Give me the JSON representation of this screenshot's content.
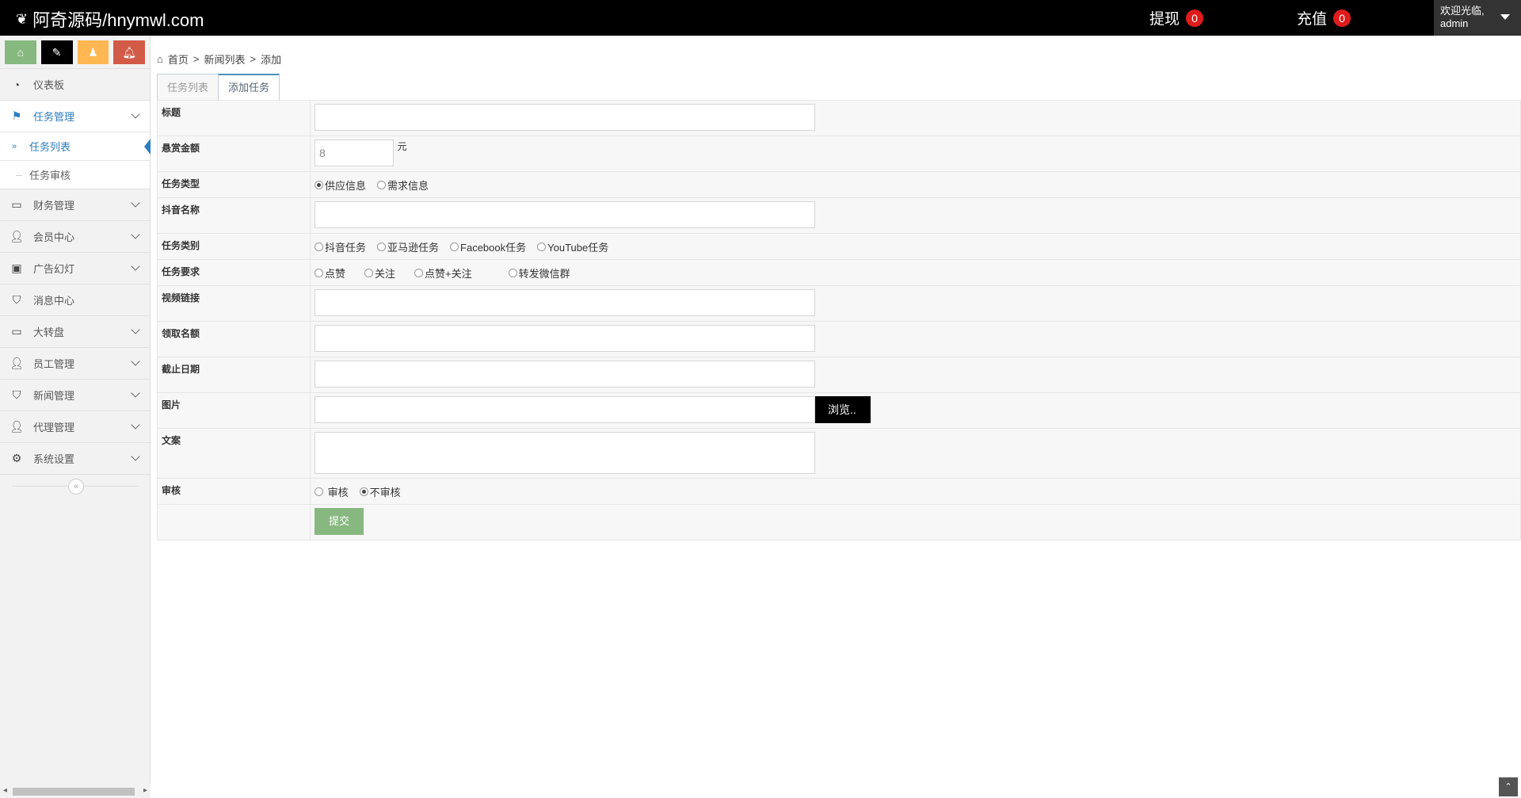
{
  "header": {
    "brand": "阿奇源码/hnymwl.com",
    "withdraw": {
      "label": "提现",
      "count": "0"
    },
    "recharge": {
      "label": "充值",
      "count": "0"
    },
    "user": {
      "welcome": "欢迎光临,",
      "name": "admin"
    }
  },
  "sidebar": {
    "items": [
      {
        "label": "仪表板"
      },
      {
        "label": "任务管理"
      },
      {
        "label": "财务管理"
      },
      {
        "label": "会员中心"
      },
      {
        "label": "广告幻灯"
      },
      {
        "label": "消息中心"
      },
      {
        "label": "大转盘"
      },
      {
        "label": "员工管理"
      },
      {
        "label": "新闻管理"
      },
      {
        "label": "代理管理"
      },
      {
        "label": "系统设置"
      }
    ],
    "sub": [
      {
        "label": "任务列表"
      },
      {
        "label": "任务审核"
      }
    ]
  },
  "breadcrumb": {
    "home": "首页",
    "sep": ">",
    "list": "新闻列表",
    "current": "添加"
  },
  "tabs": [
    {
      "label": "任务列表"
    },
    {
      "label": "添加任务"
    }
  ],
  "form": {
    "title_label": "标题",
    "reward_label": "悬赏金额",
    "reward_value": "8",
    "reward_unit": "元",
    "type_label": "任务类型",
    "type_options": [
      "供应信息",
      "需求信息"
    ],
    "douyin_label": "抖音名称",
    "category_label": "任务类别",
    "category_options": [
      "抖音任务",
      "亚马逊任务",
      "Facebook任务",
      "YouTube任务"
    ],
    "requirement_label": "任务要求",
    "requirement_options": [
      "点赞",
      "关注",
      "点赞+关注",
      "转发微信群"
    ],
    "video_label": "视频链接",
    "quota_label": "领取名额",
    "deadline_label": "截止日期",
    "image_label": "图片",
    "browse": "浏览..",
    "copy_label": "文案",
    "audit_label": "审核",
    "audit_options": [
      "审核",
      "不审核"
    ],
    "submit": "提交"
  }
}
